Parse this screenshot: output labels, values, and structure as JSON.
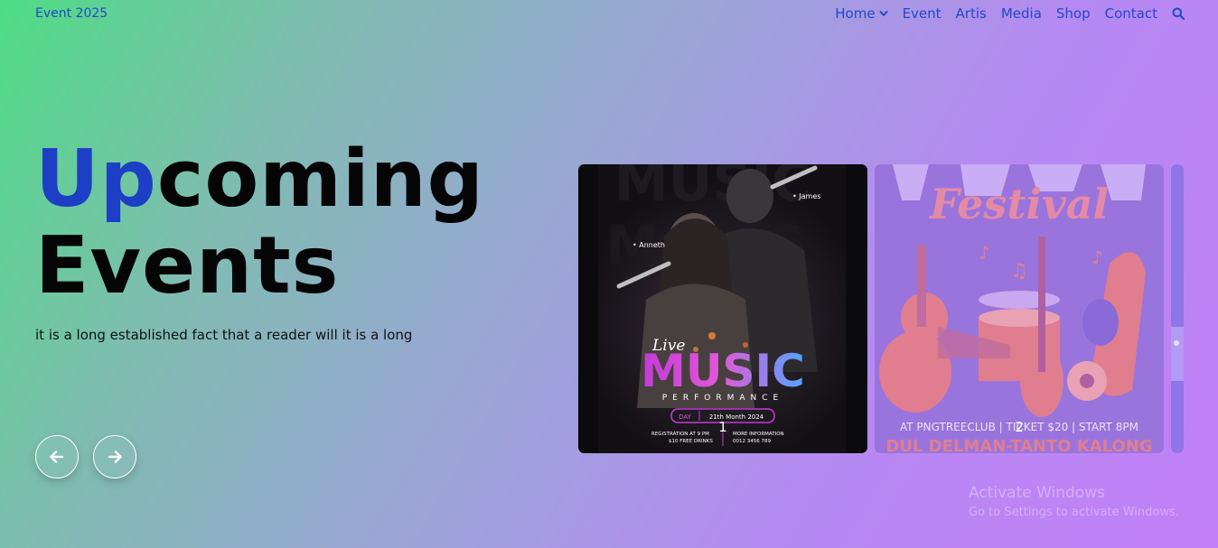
{
  "brand": "Event 2025",
  "nav": {
    "items": [
      "Home",
      "Event",
      "Artis",
      "Media",
      "Shop",
      "Contact"
    ]
  },
  "hero": {
    "title_accent": "Up",
    "title_rest": "coming",
    "title_line2": "Events",
    "subtitle": "it is a long established fact that a reader will it is a long"
  },
  "slider": {
    "cards": [
      {
        "index": "1",
        "script_word": "Live",
        "title": "MUSIC",
        "subtitle": "PERFORMANCE",
        "name_left": "• Anneth",
        "name_right": "• James",
        "day_label": "DAY",
        "date": "21th Month 2024",
        "reg_line1": "REGISTRATION AT 9 PM",
        "reg_line2": "$10 FREE DRINKS",
        "info_line1": "MORE INFORMATION",
        "info_line2": "0012 3456 789"
      },
      {
        "index": "2",
        "title": "Festival",
        "details": "AT PNGTREECLUB | TICKET $20 | START 8PM",
        "names": "DUL DELMAN-TANTO KALONG"
      }
    ]
  },
  "watermark": {
    "line1": "Activate Windows",
    "line2": "Go to Settings to activate Windows."
  },
  "colors": {
    "accent": "#1d3fc6",
    "nav_link": "#2249c7",
    "gradient_start": "#4fdd85",
    "gradient_end": "#c27ff7"
  }
}
